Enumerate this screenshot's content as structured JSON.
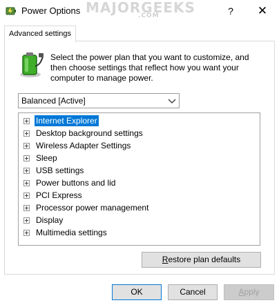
{
  "window": {
    "title": "Power Options",
    "watermark": "MAJORGEEKS",
    "watermark_sub": ".COM",
    "help_glyph": "?",
    "close_glyph": "✕"
  },
  "tab": {
    "label": "Advanced settings"
  },
  "description": {
    "line1": "Select the power plan that you want to customize, and",
    "line2": "then choose settings that reflect how you want your",
    "line3": "computer to manage power."
  },
  "plan_select": {
    "selected": "Balanced [Active]"
  },
  "settings_tree": {
    "items": [
      {
        "label": "Internet Explorer",
        "selected": true
      },
      {
        "label": "Desktop background settings"
      },
      {
        "label": "Wireless Adapter Settings"
      },
      {
        "label": "Sleep"
      },
      {
        "label": "USB settings"
      },
      {
        "label": "Power buttons and lid"
      },
      {
        "label": "PCI Express"
      },
      {
        "label": "Processor power management"
      },
      {
        "label": "Display"
      },
      {
        "label": "Multimedia settings"
      }
    ]
  },
  "buttons": {
    "restore_pre": "R",
    "restore_rest": "estore plan defaults",
    "ok": "OK",
    "cancel": "Cancel",
    "apply_pre": "A",
    "apply_rest": "pply"
  },
  "colors": {
    "selection": "#0078d7",
    "accent_green": "#3fae2a"
  },
  "icons": {
    "app": "power-options-icon",
    "plan": "battery-plug-icon",
    "expand": "plus-box-icon",
    "dropdown": "chevron-down-icon"
  }
}
